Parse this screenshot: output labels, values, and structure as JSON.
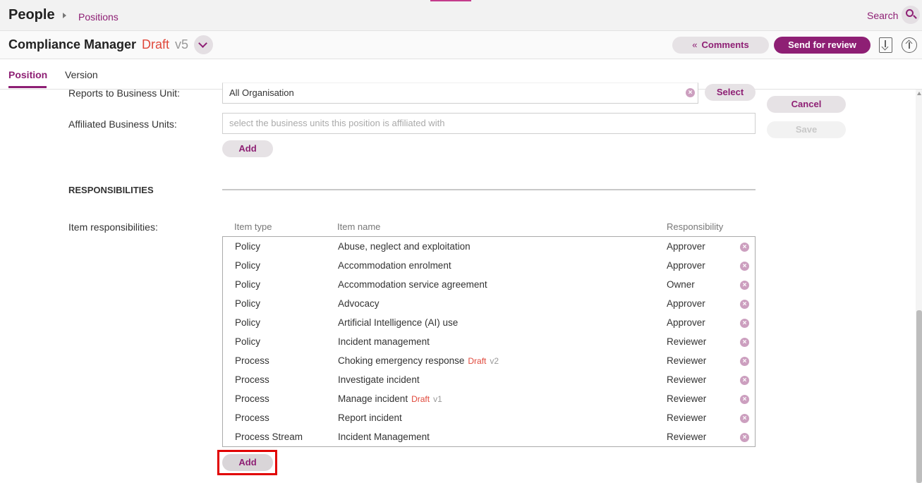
{
  "topbar": {
    "app_title": "People",
    "breadcrumb": "Positions",
    "search_label": "Search",
    "search_icon": "search-icon"
  },
  "header": {
    "title": "Compliance Manager",
    "status": "Draft",
    "version": "v5",
    "comments_label": "Comments",
    "send_review_label": "Send for review",
    "icons": [
      "chevron-down-icon",
      "download-icon",
      "upload-icon"
    ]
  },
  "tabs": [
    {
      "label": "Position",
      "active": true
    },
    {
      "label": "Version",
      "active": false
    }
  ],
  "form": {
    "reports_to": {
      "label": "Reports to Business Unit:",
      "value": "All Organisation",
      "button": "Select"
    },
    "affiliated": {
      "label": "Affiliated Business Units:",
      "placeholder": "select the business units this position is affiliated with",
      "button": "Add"
    },
    "actions": {
      "cancel": "Cancel",
      "save": "Save"
    }
  },
  "responsibilities": {
    "section_title": "RESPONSIBILITIES",
    "label": "Item responsibilities:",
    "columns": [
      "Item type",
      "Item name",
      "Responsibility"
    ],
    "rows": [
      {
        "type": "Policy",
        "name": "Abuse, neglect and exploitation",
        "status": "",
        "version": "",
        "responsibility": "Approver"
      },
      {
        "type": "Policy",
        "name": "Accommodation enrolment",
        "status": "",
        "version": "",
        "responsibility": "Approver"
      },
      {
        "type": "Policy",
        "name": "Accommodation service agreement",
        "status": "",
        "version": "",
        "responsibility": "Owner"
      },
      {
        "type": "Policy",
        "name": "Advocacy",
        "status": "",
        "version": "",
        "responsibility": "Approver"
      },
      {
        "type": "Policy",
        "name": "Artificial Intelligence (AI) use",
        "status": "",
        "version": "",
        "responsibility": "Approver"
      },
      {
        "type": "Policy",
        "name": "Incident management",
        "status": "",
        "version": "",
        "responsibility": "Reviewer"
      },
      {
        "type": "Process",
        "name": "Choking emergency response",
        "status": "Draft",
        "version": "v2",
        "responsibility": "Reviewer"
      },
      {
        "type": "Process",
        "name": "Investigate incident",
        "status": "",
        "version": "",
        "responsibility": "Reviewer"
      },
      {
        "type": "Process",
        "name": "Manage incident",
        "status": "Draft",
        "version": "v1",
        "responsibility": "Reviewer"
      },
      {
        "type": "Process",
        "name": "Report incident",
        "status": "",
        "version": "",
        "responsibility": "Reviewer"
      },
      {
        "type": "Process Stream",
        "name": "Incident Management",
        "status": "",
        "version": "",
        "responsibility": "Reviewer"
      }
    ],
    "add_label": "Add"
  },
  "colors": {
    "brand": "#8e1f74",
    "draft": "#e0483b",
    "highlight": "#e10000"
  }
}
